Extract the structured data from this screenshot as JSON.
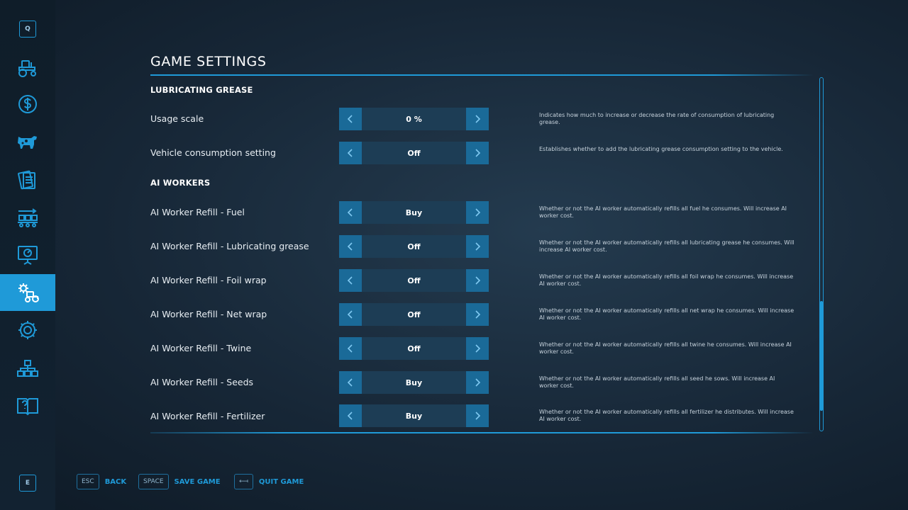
{
  "sidebar": {
    "top_key": "Q",
    "bottom_key": "E",
    "items": [
      {
        "icon": "tractor-icon",
        "active": false
      },
      {
        "icon": "dollar-icon",
        "active": false
      },
      {
        "icon": "cow-icon",
        "active": false
      },
      {
        "icon": "contracts-icon",
        "active": false
      },
      {
        "icon": "production-icon",
        "active": false
      },
      {
        "icon": "presentation-icon",
        "active": false
      },
      {
        "icon": "game-settings-icon",
        "active": true
      },
      {
        "icon": "gear-icon",
        "active": false
      },
      {
        "icon": "hierarchy-icon",
        "active": false
      },
      {
        "icon": "help-book-icon",
        "active": false
      }
    ]
  },
  "page": {
    "title": "GAME SETTINGS"
  },
  "sections": [
    {
      "heading": "LUBRICATING GREASE",
      "rows": [
        {
          "label": "Usage scale",
          "value": "0 %",
          "description": "Indicates how much to increase or decrease the rate of consumption of lubricating grease."
        },
        {
          "label": "Vehicle consumption setting",
          "value": "Off",
          "description": "Establishes whether to add the lubricating grease consumption setting to the vehicle."
        }
      ]
    },
    {
      "heading": "AI WORKERS",
      "rows": [
        {
          "label": "AI Worker Refill - Fuel",
          "value": "Buy",
          "description": "Whether or not the AI worker automatically refills all fuel he consumes. Will increase AI worker cost."
        },
        {
          "label": "AI Worker Refill - Lubricating grease",
          "value": "Off",
          "description": "Whether or not the AI worker automatically refills all lubricating grease he consumes. Will increase AI worker cost."
        },
        {
          "label": "AI Worker Refill - Foil wrap",
          "value": "Off",
          "description": "Whether or not the AI worker automatically refills all foil wrap he consumes. Will increase AI worker cost."
        },
        {
          "label": "AI Worker Refill - Net wrap",
          "value": "Off",
          "description": "Whether or not the AI worker automatically refills all net wrap he consumes. Will increase AI worker cost."
        },
        {
          "label": "AI Worker Refill - Twine",
          "value": "Off",
          "description": "Whether or not the AI worker automatically refills all twine he consumes. Will increase AI worker cost."
        },
        {
          "label": "AI Worker Refill - Seeds",
          "value": "Buy",
          "description": "Whether or not the AI worker automatically refills all seed he sows. Will increase AI worker cost."
        },
        {
          "label": "AI Worker Refill - Fertilizer",
          "value": "Buy",
          "description": "Whether or not the AI worker automatically refills all fertilizer he distributes. Will increase AI worker cost."
        }
      ]
    }
  ],
  "footer": {
    "back": {
      "key": "ESC",
      "label": "BACK"
    },
    "save": {
      "key": "SPACE",
      "label": "SAVE GAME"
    },
    "quit": {
      "key": "⟻",
      "label": "QUIT GAME"
    }
  },
  "colors": {
    "accent": "#1f9ad8",
    "arrow_bg": "#1a6a98",
    "value_bg": "#1d3d55",
    "sidebar_bg": "#0f1d29"
  }
}
